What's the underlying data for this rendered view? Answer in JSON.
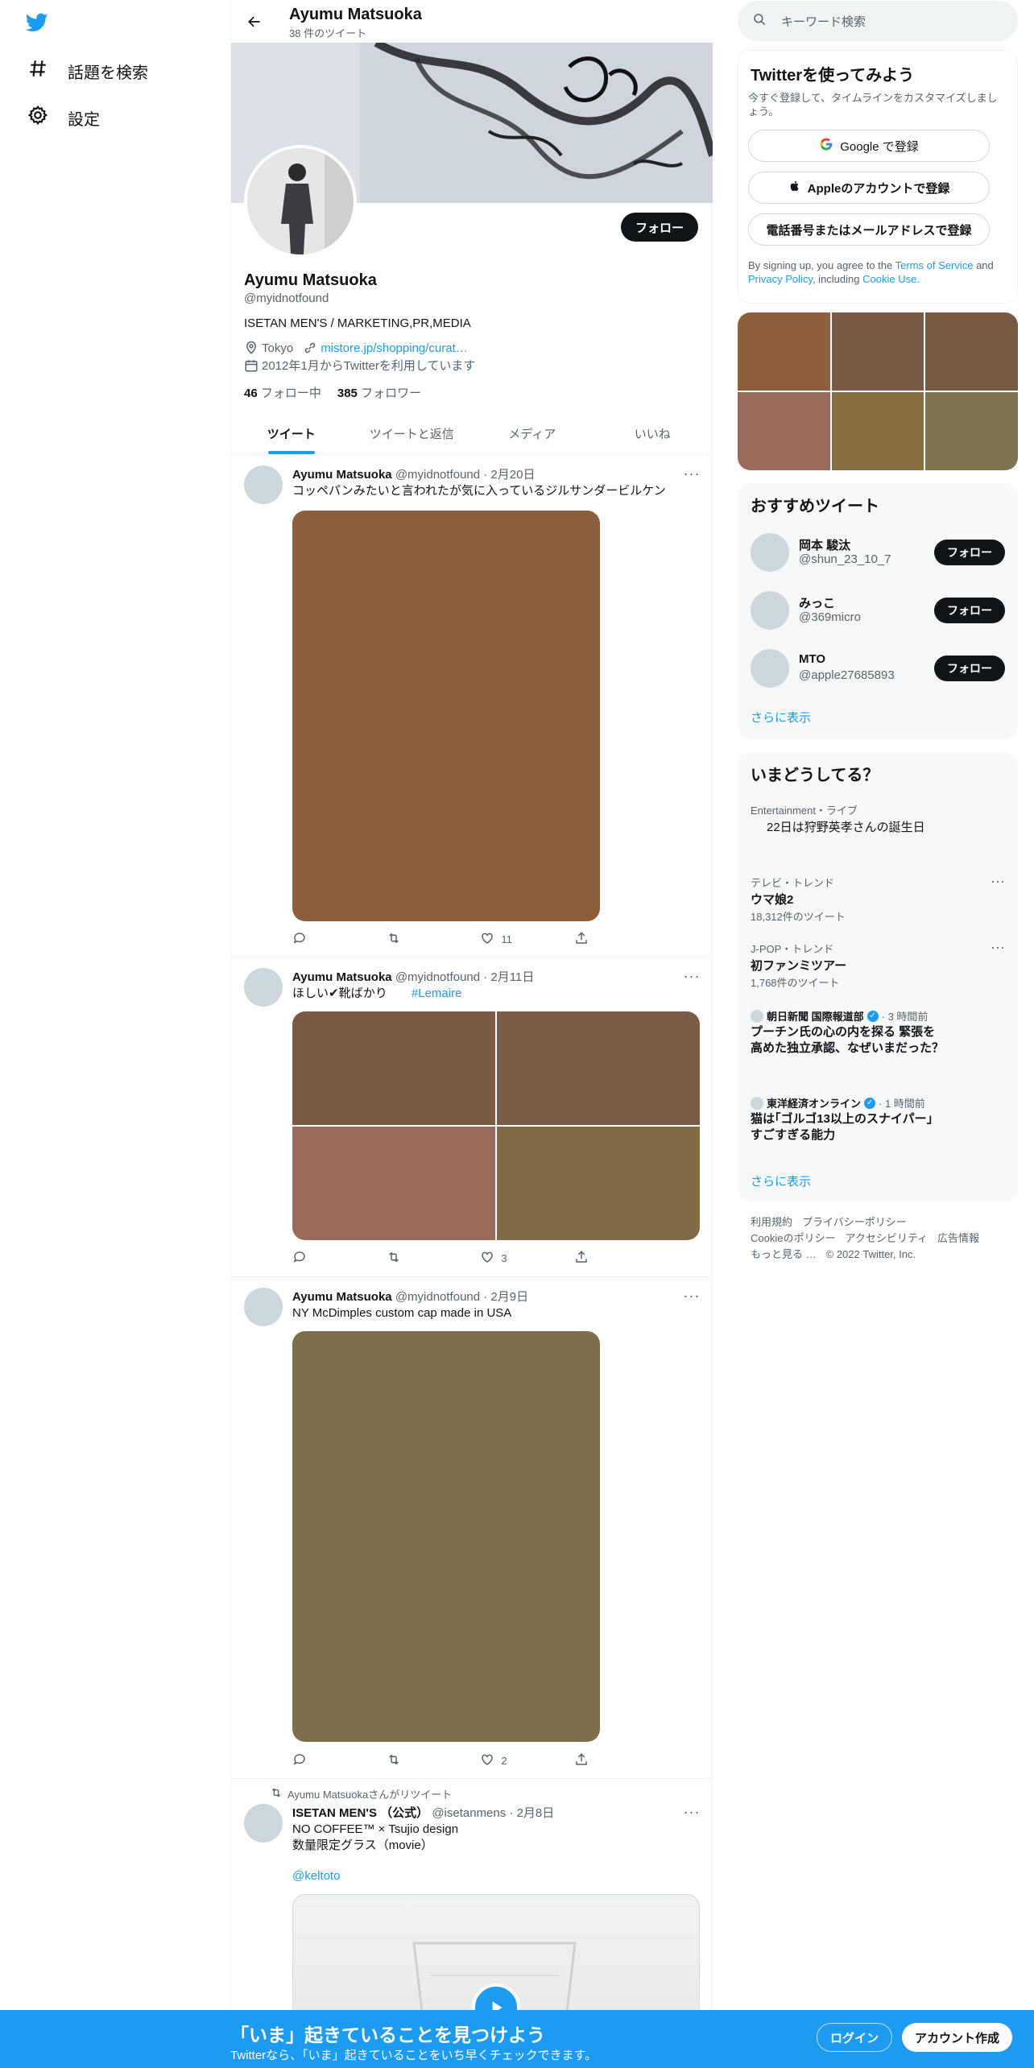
{
  "nav": {
    "items": [
      {
        "label": "話題を検索",
        "icon": "hashtag-icon"
      },
      {
        "label": "設定",
        "icon": "gear-icon"
      }
    ]
  },
  "header": {
    "name": "Ayumu Matsuoka",
    "tweet_count": "38 件のツイート"
  },
  "profile": {
    "follow_label": "フォロー",
    "name": "Ayumu Matsuoka",
    "handle": "@myidnotfound",
    "bio": "ISETAN MEN'S / MARKETING,PR,MEDIA",
    "location": "Tokyo",
    "url": "mistore.jp/shopping/curat…",
    "joined": "2012年1月からTwitterを利用しています",
    "following_count": "46",
    "following_label": "フォロー中",
    "followers_count": "385",
    "followers_label": "フォロワー"
  },
  "tabs": [
    "ツイート",
    "ツイートと返信",
    "メディア",
    "いいね"
  ],
  "tweets": [
    {
      "name": "Ayumu Matsuoka",
      "meta": "@myidnotfound · 2月20日",
      "text": "コッペパンみたいと言われたが気に入っているジルサンダービルケン",
      "likes": "11",
      "media_colors": [
        "#8b5e3c"
      ]
    },
    {
      "name": "Ayumu Matsuoka",
      "meta": "@myidnotfound · 2月11日",
      "text": "ほしい✔靴ばかり",
      "hashtag": "#Lemaire",
      "likes": "3",
      "media_colors": [
        "#7a5a44",
        "#7a5c46",
        "#9a6b5c",
        "#806b45"
      ]
    },
    {
      "name": "Ayumu Matsuoka",
      "meta": "@myidnotfound · 2月9日",
      "text": "NY McDimples custom cap made in USA",
      "likes": "2",
      "media_colors": [
        "#7f6e4a"
      ]
    },
    {
      "retweet_label": "Ayumu Matsuokaさんがリツイート",
      "name": "ISETAN MEN'S （公式）",
      "meta": "@isetanmens · 2月8日",
      "text": "NO COFFEE™ × Tsujio design\n数量限定グラス（movie）",
      "mention": "@keltoto"
    }
  ],
  "search": {
    "placeholder": "キーワード検索"
  },
  "signup": {
    "title": "Twitterを使ってみよう",
    "subtitle": "今すぐ登録して、タイムラインをカスタマイズしましょう。",
    "google": "Google で登録",
    "apple": "Appleのアカウントで登録",
    "phone": "電話番号またはメールアドレスで登録",
    "legal_prefix": "By signing up, you agree to the",
    "terms": "Terms of Service",
    "and": "and",
    "privacy": "Privacy Policy",
    "including": ", including",
    "cookie": "Cookie Use."
  },
  "photo_grid_colors": [
    "#8e5f3c",
    "#785a44",
    "#785a43",
    "#9a6a5b",
    "#86703f",
    "#7f7550"
  ],
  "recommend": {
    "title": "おすすめツイート",
    "follow_label": "フォロー",
    "users": [
      {
        "name": "岡本 駿汰",
        "handle": "@shun_23_10_7"
      },
      {
        "name": "みっこ",
        "handle": "@369micro"
      },
      {
        "name": "MTO",
        "handle": "@apple27685893"
      }
    ],
    "more": "さらに表示"
  },
  "trends": {
    "title": "いまどうしてる？",
    "items": [
      {
        "category": "Entertainment・ライブ",
        "title": "22日は狩野英孝さんの誕生日"
      },
      {
        "category": "テレビ・トレンド",
        "title": "ウマ娘2",
        "count": "18,312件のツイート"
      },
      {
        "category": "J-POP・トレンド",
        "title": "初ファンミツアー",
        "count": "1,768件のツイート"
      }
    ],
    "news": [
      {
        "source": "朝日新聞 国際報道部",
        "time": "· 3 時間前",
        "title": "プーチン氏の心の内を探る 緊張を高めた独立承認、なぜいまだった？"
      },
      {
        "source": "東洋経済オンライン",
        "time": "· 1 時間前",
        "title": "猫は｢ゴルゴ13以上のスナイパー｣ すごすぎる能力"
      }
    ],
    "more": "さらに表示"
  },
  "footer": {
    "links": [
      "利用規約",
      "プライバシーポリシー",
      "Cookieのポリシー",
      "アクセシビリティ",
      "広告情報",
      "もっと見る …"
    ],
    "copyright": "© 2022 Twitter, Inc."
  },
  "bottom": {
    "title": "「いま」起きていることを見つけよう",
    "subtitle": "Twitterなら、「いま」起きていることをいち早くチェックできます。",
    "login": "ログイン",
    "signup": "アカウント作成"
  },
  "colors": {
    "accent": "#1d9bf0",
    "text": "#0f1419",
    "muted": "#536471"
  }
}
